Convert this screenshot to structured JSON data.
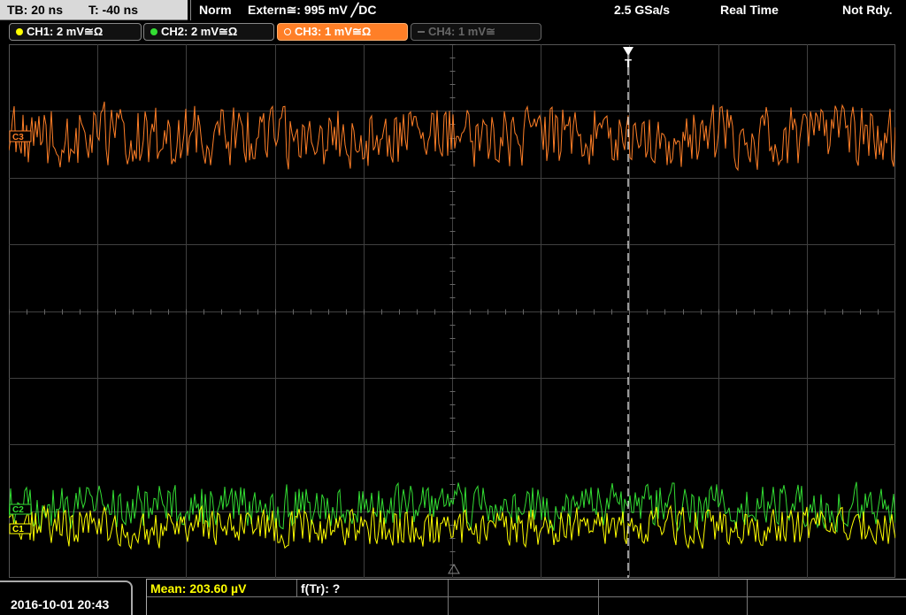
{
  "status": {
    "timebase": "TB: 20 ns",
    "trigger_offset": "T: -40 ns",
    "trigger_mode": "Norm",
    "trigger_source": "Extern≅: 995 mV ╱DC",
    "sample_rate": "2.5 GSa/s",
    "acq_mode": "Real Time",
    "acq_state": "Not Rdy."
  },
  "channels": [
    {
      "label": "CH1: 2 mV≅Ω",
      "color": "#ffff00",
      "state": "on"
    },
    {
      "label": "CH2: 2 mV≅Ω",
      "color": "#33dd33",
      "state": "on"
    },
    {
      "label": "CH3: 1 mV≅Ω",
      "color": "#ff7f27",
      "state": "active"
    },
    {
      "label": "CH4: 1 mV≅",
      "color": "#666666",
      "state": "off"
    }
  ],
  "markers": {
    "ch3": "C3",
    "ch2": "C2",
    "ch1": "C1",
    "trigger": "T"
  },
  "measurements": {
    "mean_label": "Mean: 203.60 µV",
    "freq_label": "f(Tr): ?"
  },
  "datetime": "2016-10-01 20:43",
  "colors": {
    "ch1": "#ffff00",
    "ch2": "#33dd33",
    "ch3": "#ff7f27",
    "grid": "#404040",
    "cursor": "#ffffff"
  }
}
